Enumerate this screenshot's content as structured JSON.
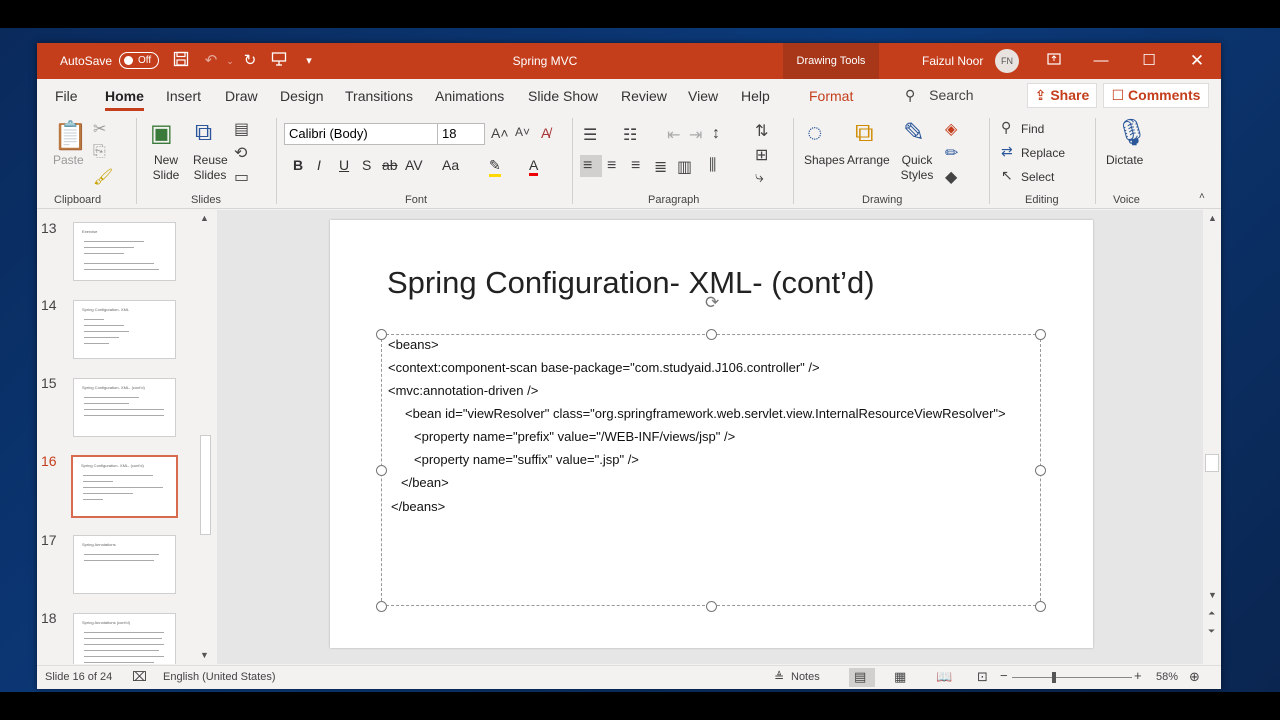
{
  "titlebar": {
    "autosave_label": "AutoSave",
    "autosave_state": "Off",
    "doc_title": "Spring MVC",
    "context_tab": "Drawing Tools",
    "user_name": "Faizul Noor",
    "user_initials": "FN"
  },
  "tabs": [
    "File",
    "Home",
    "Insert",
    "Draw",
    "Design",
    "Transitions",
    "Animations",
    "Slide Show",
    "Review",
    "View",
    "Help"
  ],
  "format_tab": "Format",
  "search_label": "Search",
  "share_label": "Share",
  "comments_label": "Comments",
  "ribbon": {
    "clipboard": {
      "paste": "Paste",
      "label": "Clipboard"
    },
    "slides": {
      "new_slide": "New Slide",
      "reuse_slides": "Reuse Slides",
      "label": "Slides"
    },
    "font": {
      "name": "Calibri (Body)",
      "size": "18",
      "label": "Font"
    },
    "paragraph": {
      "label": "Paragraph"
    },
    "drawing": {
      "shapes": "Shapes",
      "arrange": "Arrange",
      "quick_styles": "Quick Styles",
      "label": "Drawing"
    },
    "editing": {
      "find": "Find",
      "replace": "Replace",
      "select": "Select",
      "label": "Editing"
    },
    "voice": {
      "dictate": "Dictate",
      "label": "Voice"
    }
  },
  "thumbnails": [
    {
      "num": "13",
      "title": "Exercise",
      "active": false
    },
    {
      "num": "14",
      "title": "Spring Configuration- XML",
      "active": false
    },
    {
      "num": "15",
      "title": "Spring Configuration- XML- (cont'd)",
      "active": false
    },
    {
      "num": "16",
      "title": "Spring Configuration- XML- (cont'd)",
      "active": true
    },
    {
      "num": "17",
      "title": "Spring Annotations",
      "active": false
    },
    {
      "num": "18",
      "title": "Spring Annotations (cont'd)",
      "active": false
    }
  ],
  "slide": {
    "title": "Spring Configuration- XML- (cont’d)",
    "code": [
      "<beans>",
      "<context:component-scan base-package=\"com.studyaid.J106.controller\" />",
      "<mvc:annotation-driven />",
      "<bean id=\"viewResolver\" class=\"org.springframework.web.servlet.view.InternalResourceViewResolver\">",
      "<property name=\"prefix\" value=\"/WEB-INF/views/jsp\" />",
      "<property name=\"suffix\" value=\".jsp\" />",
      "</bean>",
      "</beans>"
    ]
  },
  "status": {
    "slide_indicator": "Slide 16 of 24",
    "language": "English (United States)",
    "notes": "Notes",
    "zoom": "58%"
  }
}
